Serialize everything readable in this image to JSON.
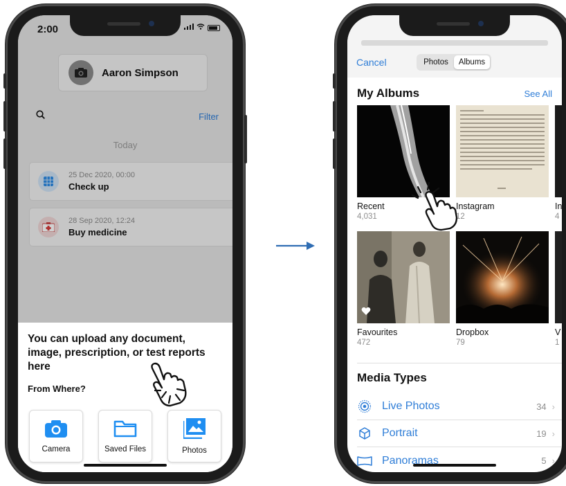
{
  "left_phone": {
    "status": {
      "time": "2:00"
    },
    "user": {
      "name": "Aaron Simpson"
    },
    "search": {
      "filter_label": "Filter"
    },
    "section_label": "Today",
    "records": [
      {
        "date": "25 Dec 2020, 00:00",
        "title": "Check up",
        "icon": "calendar-grid-icon"
      },
      {
        "date": "28 Sep 2020, 12:24",
        "title": "Buy medicine",
        "icon": "medicine-kit-icon"
      }
    ],
    "sheet": {
      "title": "You can upload any document, image, prescription, or test reports here",
      "from_label": "From Where?",
      "options": [
        {
          "label": "Camera",
          "icon": "camera-icon"
        },
        {
          "label": "Saved Files",
          "icon": "folder-icon"
        },
        {
          "label": "Photos",
          "icon": "photos-icon"
        }
      ]
    }
  },
  "right_phone": {
    "cancel_label": "Cancel",
    "segments": [
      {
        "label": "Photos",
        "active": false
      },
      {
        "label": "Albums",
        "active": true
      }
    ],
    "my_albums": {
      "title": "My Albums",
      "see_all": "See All",
      "albums": [
        {
          "name": "Recent",
          "count": "4,031"
        },
        {
          "name": "Instagram",
          "count": "12"
        },
        {
          "name": "Favourites",
          "count": "472"
        },
        {
          "name": "Dropbox",
          "count": "79"
        }
      ],
      "partial_third_column": [
        {
          "name": "In",
          "count": "4"
        },
        {
          "name": "V",
          "count": "1"
        }
      ]
    },
    "media_types": {
      "title": "Media Types",
      "items": [
        {
          "label": "Live Photos",
          "count": "34",
          "icon": "live-photos-icon"
        },
        {
          "label": "Portrait",
          "count": "19",
          "icon": "portrait-cube-icon"
        },
        {
          "label": "Panoramas",
          "count": "5",
          "icon": "panorama-icon"
        }
      ]
    }
  },
  "colors": {
    "accent": "#2e7dd7",
    "icon_blue": "#1f8ef1",
    "dim_overlay": "rgba(0,0,0,0.18)"
  }
}
